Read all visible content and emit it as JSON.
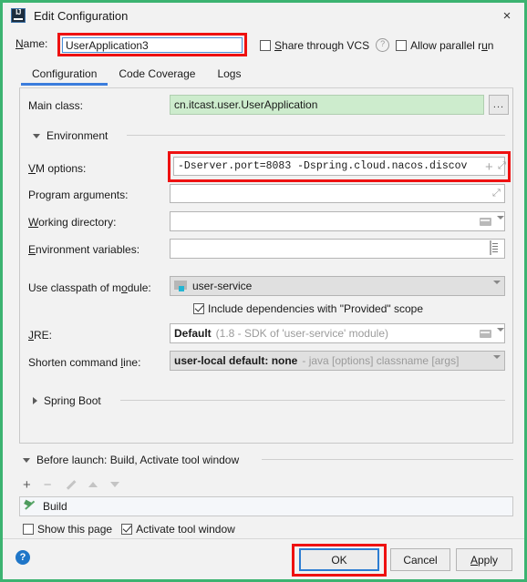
{
  "window": {
    "title": "Edit Configuration",
    "app_icon": "intellij-idea-icon",
    "close_icon": "×"
  },
  "name_row": {
    "label": "Name:",
    "value": "UserApplication3",
    "share_vcs_label": "Share through VCS",
    "share_vcs_checked": false,
    "help_icon": "?",
    "allow_parallel_label": "Allow parallel run",
    "allow_parallel_checked": false
  },
  "tabs": [
    {
      "label": "Configuration",
      "active": true
    },
    {
      "label": "Code Coverage",
      "active": false
    },
    {
      "label": "Logs",
      "active": false
    }
  ],
  "configuration": {
    "main_class": {
      "label": "Main class:",
      "value": "cn.itcast.user.UserApplication",
      "browse_label": "..."
    },
    "environment_section": {
      "label": "Environment",
      "expanded": true
    },
    "vm_options": {
      "label": "VM options:",
      "value": "-Dserver.port=8083 -Dspring.cloud.nacos.discov",
      "insert_icon": "+",
      "expand_icon": "⤢"
    },
    "program_arguments": {
      "label": "Program arguments:",
      "value": "",
      "expand_icon": "⤢"
    },
    "working_directory": {
      "label": "Working directory:",
      "value": "",
      "folder_icon": "folder-icon",
      "dropdown_icon": "chevron-down-icon"
    },
    "environment_variables": {
      "label": "Environment variables:",
      "value": "",
      "editor_icon": "list-editor-icon"
    },
    "use_classpath_of_module": {
      "label": "Use classpath of module:",
      "value": "user-service",
      "module_icon": "module-icon",
      "dropdown_icon": "chevron-down-icon"
    },
    "include_dependencies": {
      "label": "Include dependencies with \"Provided\" scope",
      "checked": true
    },
    "jre": {
      "label": "JRE:",
      "value": "Default",
      "hint": "(1.8 - SDK of 'user-service' module)",
      "folder_icon": "folder-icon",
      "dropdown_icon": "chevron-down-icon"
    },
    "shorten_command_line": {
      "label": "Shorten command line:",
      "value": "user-local default: none",
      "hint": "- java [options] classname [args]",
      "dropdown_icon": "chevron-down-icon"
    },
    "spring_boot_section": {
      "label": "Spring Boot",
      "expanded": false
    }
  },
  "before_launch": {
    "header": "Before launch: Build, Activate tool window",
    "toolbar": {
      "add_icon": "+",
      "remove_icon": "−",
      "edit_icon": "pencil-icon",
      "move_up_icon": "arrow-up-icon",
      "move_down_icon": "arrow-down-icon"
    },
    "items": [
      {
        "label": "Build",
        "icon": "hammer-icon"
      }
    ],
    "show_this_page": {
      "label": "Show this page",
      "checked": false
    },
    "activate_tool_window": {
      "label": "Activate tool window",
      "checked": true
    }
  },
  "footer": {
    "help_icon": "?",
    "ok_label": "OK",
    "cancel_label": "Cancel",
    "apply_label": "Apply",
    "apply_mnemonic": "A"
  },
  "annotations": {
    "highlight_color": "#ee1111",
    "boxes": [
      "name-field",
      "vm-options-field",
      "ok-button"
    ]
  },
  "colors": {
    "window_border": "#3cb371",
    "accent_blue": "#3b7ddd",
    "valid_field_green": "#cdeccd",
    "panel_background": "#f2f2f2"
  }
}
